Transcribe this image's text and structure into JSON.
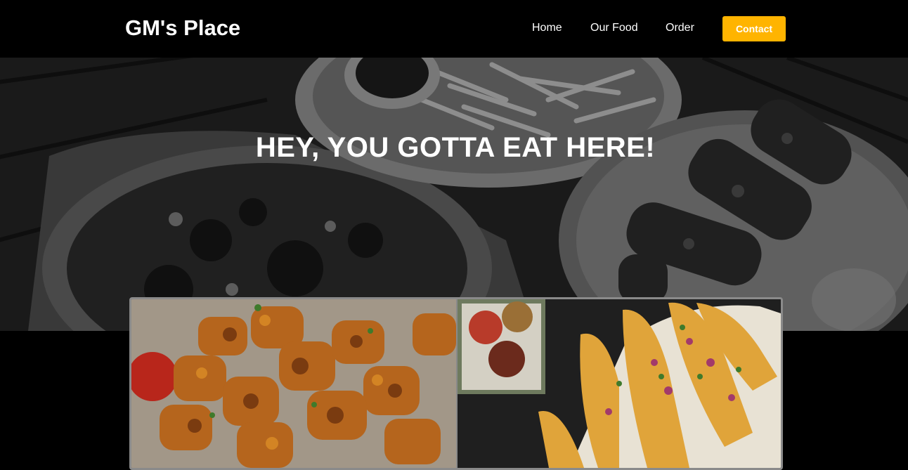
{
  "navbar": {
    "brand": "GM's Place",
    "links": {
      "home": "Home",
      "our_food": "Our Food",
      "order": "Order"
    },
    "contact_label": "Contact",
    "accent_color": "#ffb400"
  },
  "hero": {
    "title": "HEY, YOU GOTTA EAT HERE!",
    "background": "grayscale food photo"
  },
  "gallery": {
    "images": [
      {
        "name": "grilled-chicken-skewers-image"
      },
      {
        "name": "stuffed-peppers-image"
      }
    ]
  }
}
